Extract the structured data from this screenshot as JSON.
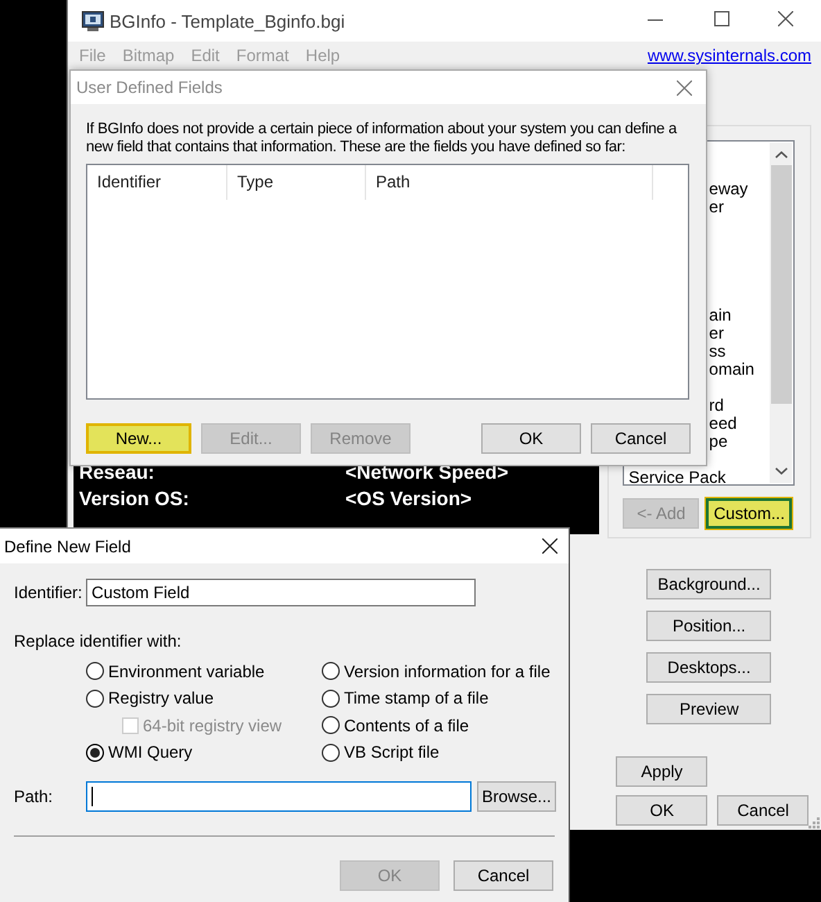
{
  "main_window": {
    "title": "BGInfo - Template_Bginfo.bgi",
    "menu": [
      "File",
      "Bitmap",
      "Edit",
      "Format",
      "Help"
    ],
    "link": "www.sysinternals.com",
    "canvas_lines": [
      {
        "label": "Reseau:",
        "value": "<Network Speed>"
      },
      {
        "label": "Version OS:",
        "value": "<OS Version>"
      }
    ],
    "field_list": [
      {
        "text": "eway",
        "kind": "partial"
      },
      {
        "text": "er",
        "kind": "partial"
      },
      {
        "text": "ain",
        "kind": "partial"
      },
      {
        "text": "er",
        "kind": "partial"
      },
      {
        "text": "ss",
        "kind": "partial"
      },
      {
        "text": "omain",
        "kind": "partial"
      },
      {
        "text": "rd",
        "kind": "partial"
      },
      {
        "text": "eed",
        "kind": "partial"
      },
      {
        "text": "pe",
        "kind": "partial"
      },
      {
        "text": "Service Pack",
        "kind": "full"
      }
    ],
    "add_button": {
      "label": "<- Add",
      "disabled": true
    },
    "custom_button": {
      "label": "Custom...",
      "highlighted": true
    },
    "side_buttons": [
      "Background...",
      "Position...",
      "Desktops...",
      "Preview"
    ],
    "apply_button": "Apply",
    "ok_button": "OK",
    "cancel_button": "Cancel"
  },
  "user_fields_dialog": {
    "title": "User Defined Fields",
    "intro": "If BGInfo does not provide a certain piece of information about your system you can define a new field that contains that information. These are the fields you have defined so far:",
    "columns": [
      "Identifier",
      "Type",
      "Path"
    ],
    "buttons": [
      {
        "label": "New...",
        "disabled": false,
        "highlighted": true,
        "kind": "left"
      },
      {
        "label": "Edit...",
        "disabled": true,
        "highlighted": false,
        "kind": "left"
      },
      {
        "label": "Remove",
        "disabled": true,
        "highlighted": false,
        "kind": "left"
      },
      {
        "label": "OK",
        "disabled": false,
        "highlighted": false,
        "kind": "right"
      },
      {
        "label": "Cancel",
        "disabled": false,
        "highlighted": false,
        "kind": "right"
      }
    ]
  },
  "define_dialog": {
    "title": "Define New Field",
    "identifier_label": "Identifier:",
    "identifier_value": "Custom Field",
    "replace_label": "Replace identifier with:",
    "option_columns": [
      [
        {
          "kind": "radio",
          "label": "Environment variable",
          "selected": false
        },
        {
          "kind": "radio",
          "label": "Registry value",
          "selected": false
        },
        {
          "kind": "checkbox",
          "label": "64-bit registry view",
          "checked": false,
          "disabled": true
        },
        {
          "kind": "radio",
          "label": "WMI Query",
          "selected": true
        }
      ],
      [
        {
          "kind": "radio",
          "label": "Version information for a file",
          "selected": false
        },
        {
          "kind": "radio",
          "label": "Time stamp of a file",
          "selected": false
        },
        {
          "kind": "radio",
          "label": "Contents of a file",
          "selected": false
        },
        {
          "kind": "radio",
          "label": "VB Script file",
          "selected": false
        }
      ]
    ],
    "path_label": "Path:",
    "path_focused": true,
    "browse_button": "Browse...",
    "ok_button": {
      "label": "OK",
      "disabled": true
    },
    "cancel_button": {
      "label": "Cancel",
      "disabled": false
    }
  }
}
